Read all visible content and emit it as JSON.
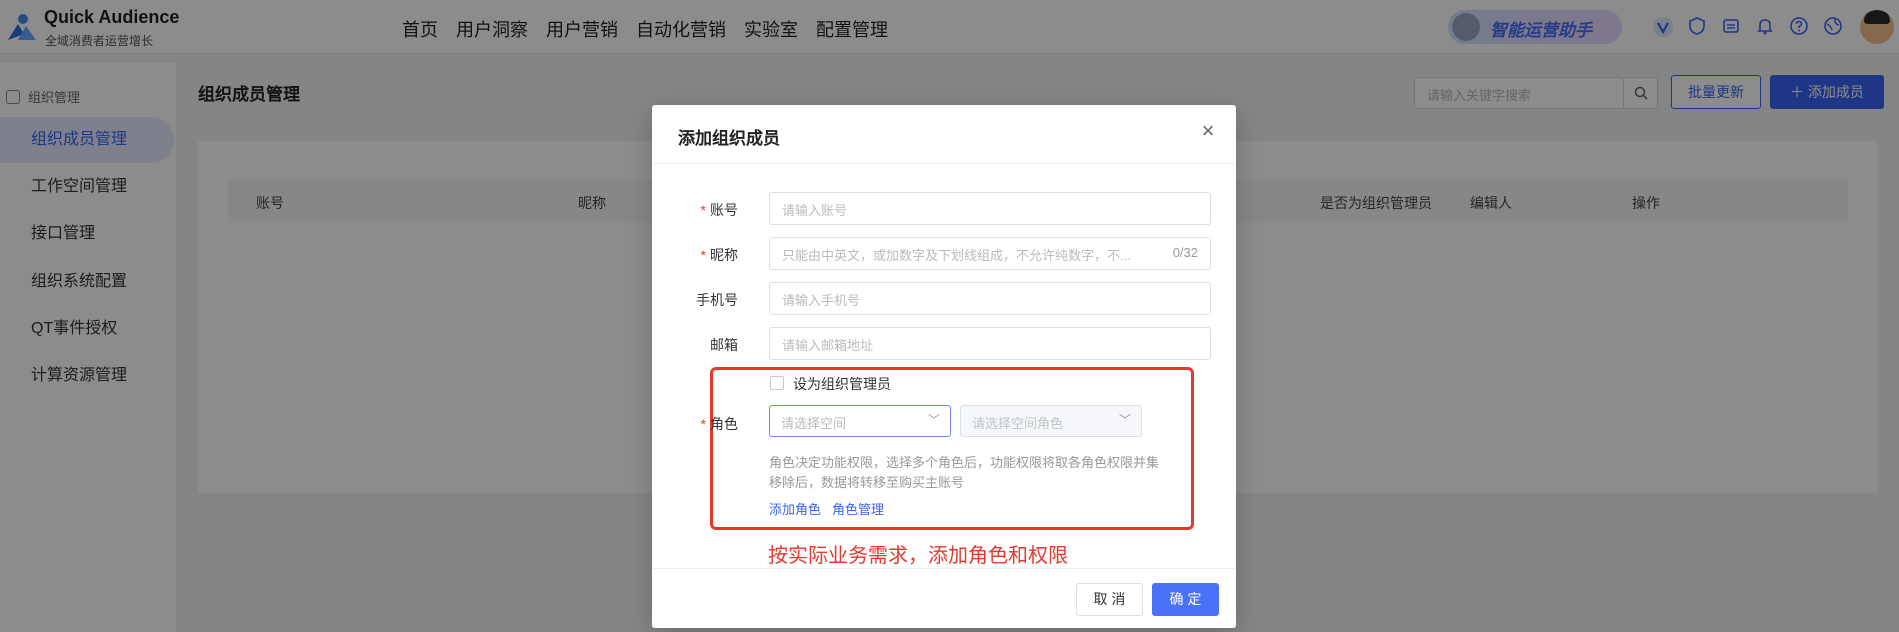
{
  "header": {
    "app_name": "Quick Audience",
    "app_subtitle": "全域消费者运营增长",
    "nav": [
      "首页",
      "用户洞察",
      "用户营销",
      "自动化营销",
      "实验室",
      "配置管理"
    ],
    "assistant_label": "智能运营助手",
    "icons": [
      "v-icon",
      "shield-icon",
      "message-icon",
      "bell-icon",
      "help-icon",
      "globe-icon"
    ]
  },
  "sidebar": {
    "group_label": "组织管理",
    "items": [
      {
        "label": "组织成员管理",
        "active": true
      },
      {
        "label": "工作空间管理"
      },
      {
        "label": "接口管理"
      },
      {
        "label": "组织系统配置"
      },
      {
        "label": "QT事件授权"
      },
      {
        "label": "计算资源管理"
      }
    ]
  },
  "main": {
    "title": "组织成员管理",
    "search_placeholder": "请输入关键字搜索",
    "bulk_update_label": "批量更新",
    "add_member_label": "添加成员",
    "table_headers": [
      "账号",
      "昵称",
      "是否为组织管理员",
      "编辑人",
      "操作"
    ]
  },
  "modal": {
    "title": "添加组织成员",
    "fields": {
      "account_label": "账号",
      "account_placeholder": "请输入账号",
      "nickname_label": "昵称",
      "nickname_placeholder": "只能由中英文，或加数字及下划线组成，不允许纯数字，不...",
      "nickname_count": "0/32",
      "phone_label": "手机号",
      "phone_placeholder": "请输入手机号",
      "email_label": "邮箱",
      "email_placeholder": "请输入邮箱地址",
      "admin_checkbox_label": "设为组织管理员",
      "role_label": "角色",
      "space_placeholder": "请选择空间",
      "space_role_placeholder": "请选择空间角色",
      "hint_line1": "角色决定功能权限，选择多个角色后，功能权限将取各角色权限并集",
      "hint_line2": "移除后，数据将转移至购买主账号",
      "add_role_link": "添加角色",
      "role_manage_link": "角色管理"
    },
    "annotation": "按实际业务需求，添加角色和权限",
    "cancel_label": "取 消",
    "ok_label": "确 定"
  },
  "colors": {
    "primary": "#3a63f5",
    "highlight_border": "#e53930",
    "required": "#e53935"
  }
}
